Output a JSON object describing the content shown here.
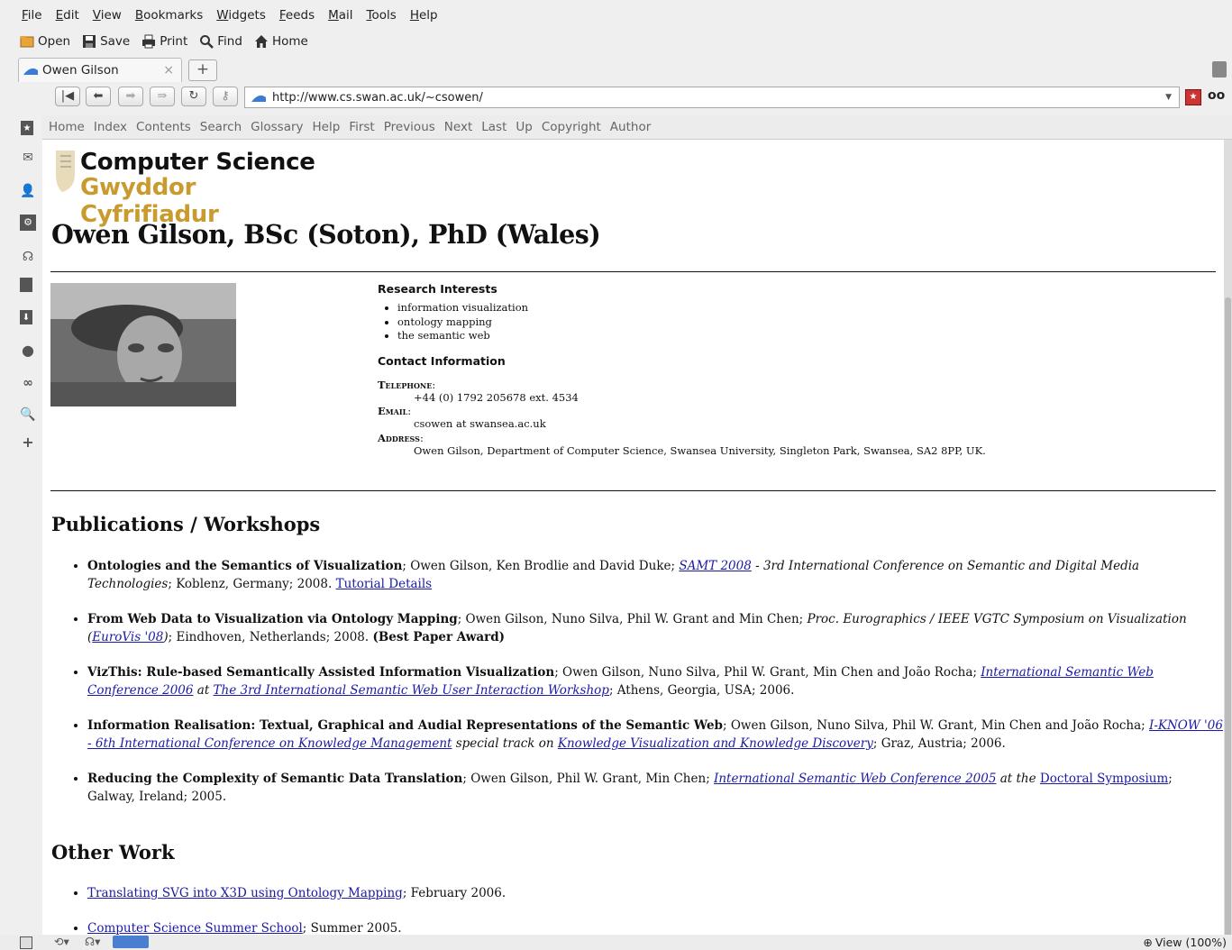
{
  "menu": [
    "File",
    "Edit",
    "View",
    "Bookmarks",
    "Widgets",
    "Feeds",
    "Mail",
    "Tools",
    "Help"
  ],
  "toolbar": {
    "open": "Open",
    "save": "Save",
    "print": "Print",
    "find": "Find",
    "home": "Home"
  },
  "tab": {
    "title": "Owen Gilson",
    "close": "×"
  },
  "url": "http://www.cs.swan.ac.uk/~csowen/",
  "sitenav": [
    "Home",
    "Index",
    "Contents",
    "Search",
    "Glossary",
    "Help",
    "First",
    "Previous",
    "Next",
    "Last",
    "Up",
    "Copyright",
    "Author"
  ],
  "logo": {
    "en": "Computer Science",
    "cy": "Gwyddor Cyfrifiadur"
  },
  "heading": "Owen Gilson, BSc (Soton), PhD (Wales)",
  "research": {
    "title": "Research Interests",
    "items": [
      "information visualization",
      "ontology mapping",
      "the semantic web"
    ]
  },
  "contact": {
    "title": "Contact Information",
    "tel_label": "Telephone",
    "tel": "+44 (0) 1792 205678 ext. 4534",
    "email_label": "Email",
    "email": "csowen at swansea.ac.uk",
    "addr_label": "Address",
    "addr": "Owen Gilson, Department of Computer Science, Swansea University, Singleton Park, Swansea, SA2 8PP, UK."
  },
  "pubs_title": "Publications / Workshops",
  "pubs": [
    {
      "t": "Ontologies and the Semantics of Visualization",
      "a": "; Owen Gilson, Ken Brodlie and David Duke; ",
      "l1": "SAMT 2008",
      "m": " - 3rd International Conference on Semantic and Digital Media Technologies",
      "e": "; Koblenz, Germany; 2008. ",
      "l2": "Tutorial Details"
    },
    {
      "t": "From Web Data to Visualization via Ontology Mapping",
      "a": "; Owen Gilson, Nuno Silva, Phil W. Grant and Min Chen; ",
      "m": "Proc. Eurographics / IEEE VGTC Symposium on Visualization (",
      "l1": "EuroVis '08",
      "m2": ")",
      "e": "; Eindhoven, Netherlands; 2008. ",
      "b": "(Best Paper Award)"
    },
    {
      "t": "VizThis: Rule-based Semantically Assisted Information Visualization",
      "a": "; Owen Gilson, Nuno Silva, Phil W. Grant, Min Chen and João Rocha; ",
      "l1": "International Semantic Web Conference 2006",
      "m": " at ",
      "l2": "The 3rd International Semantic Web User Interaction Workshop",
      "e": "; Athens, Georgia, USA; 2006."
    },
    {
      "t": "Information Realisation: Textual, Graphical and Audial Representations of the Semantic Web",
      "a": "; Owen Gilson, Nuno Silva, Phil W. Grant, Min Chen and João Rocha; ",
      "l1": "I-KNOW '06 - 6th International Conference on Knowledge Management",
      "m": " special track on ",
      "l2": "Knowledge Visualization and Knowledge Discovery",
      "e": "; Graz, Austria; 2006."
    },
    {
      "t": "Reducing the Complexity of Semantic Data Translation",
      "a": "; Owen Gilson, Phil W. Grant, Min Chen; ",
      "l1": "International Semantic Web Conference 2005",
      "m": " at the ",
      "l2": "Doctoral Symposium",
      "e": "; Galway, Ireland; 2005."
    }
  ],
  "other_title": "Other Work",
  "other": [
    {
      "l": "Translating SVG into X3D using Ontology Mapping",
      "e": "; February 2006."
    },
    {
      "l": "Computer Science Summer School",
      "e": "; Summer 2005."
    }
  ],
  "status": {
    "zoom": "View (100%)"
  }
}
